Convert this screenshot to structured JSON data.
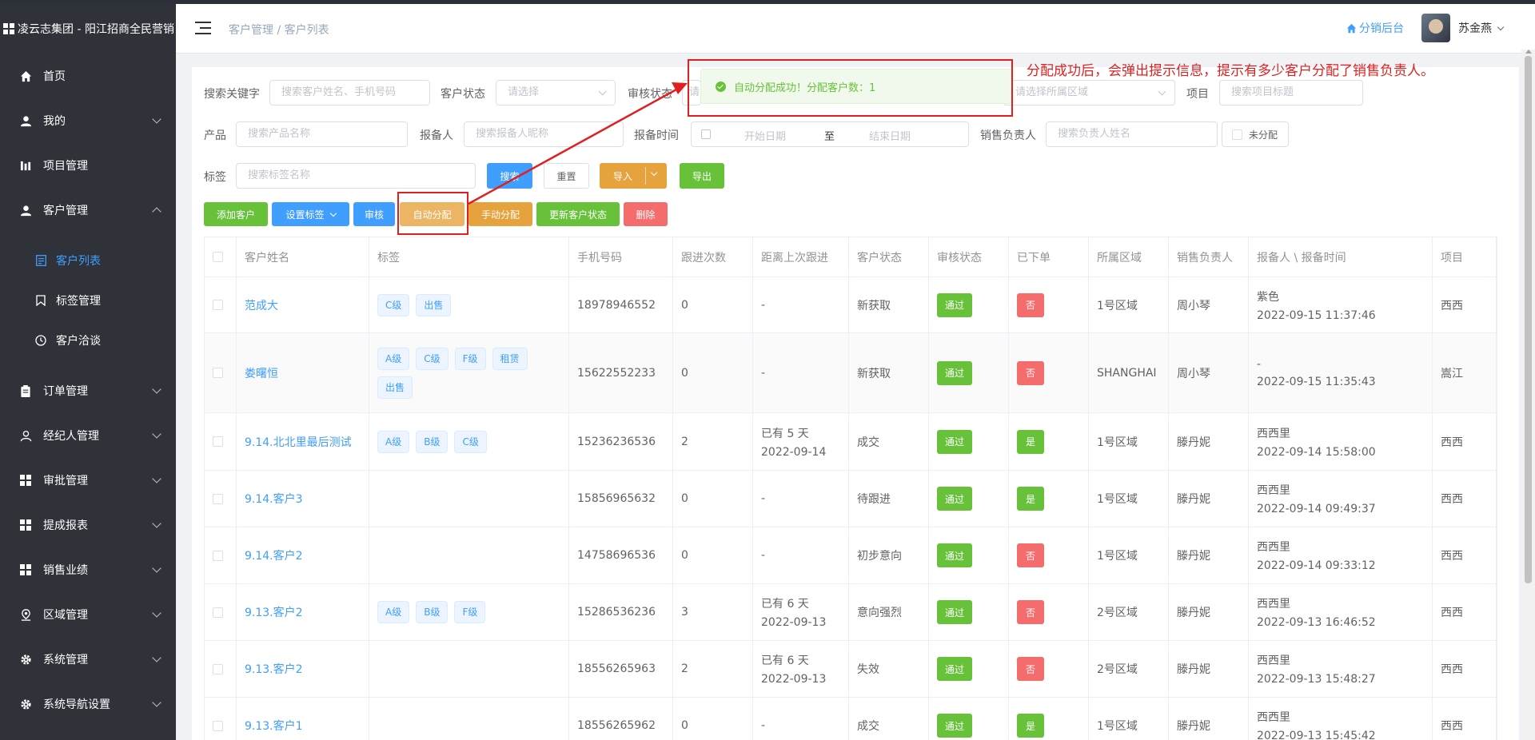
{
  "brand": {
    "title": "凌云志集团 - 阳江招商全民营销"
  },
  "sidebar": {
    "items": [
      {
        "label": "首页"
      },
      {
        "label": "我的"
      },
      {
        "label": "项目管理"
      },
      {
        "label": "客户管理"
      },
      {
        "label": "订单管理"
      },
      {
        "label": "经纪人管理"
      },
      {
        "label": "审批管理"
      },
      {
        "label": "提成报表"
      },
      {
        "label": "销售业绩"
      },
      {
        "label": "区域管理"
      },
      {
        "label": "系统管理"
      },
      {
        "label": "系统导航设置"
      }
    ],
    "sub": [
      {
        "label": "客户列表"
      },
      {
        "label": "标签管理"
      },
      {
        "label": "客户洽谈"
      }
    ]
  },
  "header": {
    "breadcrumb": "客户管理 / 客户列表",
    "dist_link": "分销后台",
    "user": "苏金燕"
  },
  "filters": {
    "keyword_label": "搜索关键字",
    "keyword_ph": "搜索客户姓名、手机号码",
    "status_label": "客户状态",
    "status_ph": "请选择",
    "audit_label": "审核状态",
    "audit_ph": "请",
    "region_ph": "请选择所属区域",
    "project_label": "项目",
    "project_ph": "搜索项目标题",
    "product_label": "产品",
    "product_ph": "搜索产品名称",
    "reporter_label": "报备人",
    "reporter_ph": "搜索报备人昵称",
    "report_time_label": "报备时间",
    "start_ph": "开始日期",
    "to": "至",
    "end_ph": "结束日期",
    "sales_label": "销售负责人",
    "sales_ph": "搜索负责人姓名",
    "unassigned": "未分配",
    "tag_label": "标签",
    "tag_ph": "搜索标签名称",
    "search_btn": "搜索",
    "reset_btn": "重置",
    "import_btn": "导入",
    "export_btn": "导出"
  },
  "toolbar": {
    "add": "添加客户",
    "set_tag": "设置标签",
    "audit": "审核",
    "auto_assign": "自动分配",
    "manual_assign": "手动分配",
    "update_status": "更新客户状态",
    "delete": "删除"
  },
  "table": {
    "headers": [
      "客户姓名",
      "标签",
      "手机号码",
      "跟进次数",
      "距离上次跟进",
      "客户状态",
      "审核状态",
      "已下单",
      "所属区域",
      "销售负责人",
      "报备人 \\ 报备时间",
      "项目"
    ],
    "rows": [
      {
        "name": "范成大",
        "tags": [
          "C级",
          "出售"
        ],
        "phone": "18978946552",
        "follow": "0",
        "last1": "-",
        "last2": "",
        "status": "新获取",
        "audit": "通过",
        "ordered": "否",
        "region": "1号区域",
        "sales": "周小琴",
        "reporter": "紫色",
        "time": "2022-09-15 11:37:46",
        "project": "西西"
      },
      {
        "name": "娄曙恒",
        "tags": [
          "A级",
          "C级",
          "F级",
          "租赁",
          "出售"
        ],
        "phone": "15622552233",
        "follow": "0",
        "last1": "-",
        "last2": "",
        "status": "新获取",
        "audit": "通过",
        "ordered": "否",
        "region": "SHANGHAI",
        "sales": "周小琴",
        "reporter": "-",
        "time": "2022-09-15 11:35:43",
        "project": "嵩江"
      },
      {
        "name": "9.14.北北里最后测试",
        "tags": [
          "A级",
          "B级",
          "C级"
        ],
        "phone": "15236236536",
        "follow": "2",
        "last1": "已有 5 天",
        "last2": "2022-09-14",
        "status": "成交",
        "audit": "通过",
        "ordered": "是",
        "region": "1号区域",
        "sales": "滕丹妮",
        "reporter": "西西里",
        "time": "2022-09-14 15:58:00",
        "project": "西西"
      },
      {
        "name": "9.14.客户3",
        "tags": [],
        "phone": "15856965632",
        "follow": "0",
        "last1": "-",
        "last2": "",
        "status": "待跟进",
        "audit": "通过",
        "ordered": "是",
        "region": "1号区域",
        "sales": "滕丹妮",
        "reporter": "西西里",
        "time": "2022-09-14 09:49:37",
        "project": "西西"
      },
      {
        "name": "9.14.客户2",
        "tags": [],
        "phone": "14758696536",
        "follow": "0",
        "last1": "-",
        "last2": "",
        "status": "初步意向",
        "audit": "通过",
        "ordered": "否",
        "region": "1号区域",
        "sales": "滕丹妮",
        "reporter": "西西里",
        "time": "2022-09-14 09:33:12",
        "project": "西西"
      },
      {
        "name": "9.13.客户2",
        "tags": [
          "A级",
          "B级",
          "F级"
        ],
        "phone": "15286536236",
        "follow": "3",
        "last1": "已有 6 天",
        "last2": "2022-09-13",
        "status": "意向强烈",
        "audit": "通过",
        "ordered": "否",
        "region": "2号区域",
        "sales": "滕丹妮",
        "reporter": "西西里",
        "time": "2022-09-13 16:46:52",
        "project": "西西"
      },
      {
        "name": "9.13.客户2",
        "tags": [],
        "phone": "18556265963",
        "follow": "2",
        "last1": "已有 6 天",
        "last2": "2022-09-13",
        "status": "失效",
        "audit": "通过",
        "ordered": "否",
        "region": "2号区域",
        "sales": "滕丹妮",
        "reporter": "西西里",
        "time": "2022-09-13 15:48:27",
        "project": "西西"
      },
      {
        "name": "9.13.客户1",
        "tags": [],
        "phone": "18556265962",
        "follow": "0",
        "last1": "-",
        "last2": "",
        "status": "成交",
        "audit": "通过",
        "ordered": "是",
        "region": "1号区域",
        "sales": "滕丹妮",
        "reporter": "西西里",
        "time": "2022-09-13 15:45:42",
        "project": "西西"
      }
    ]
  },
  "toast": {
    "message": "自动分配成功！分配客户数：1"
  },
  "annotation": {
    "text": "分配成功后，会弹出提示信息，提示有多少客户分配了销售负责人。"
  },
  "colors": {
    "accent": "#409eff",
    "success": "#67c23a",
    "danger": "#f56c6c",
    "warning": "#e6a23c",
    "annotation": "#e02020"
  }
}
